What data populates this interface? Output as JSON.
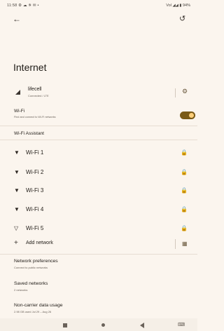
{
  "status": {
    "left": "11:58 ⚙ ☁ ✵ ✉ •",
    "right": "Vol ◢◢ ▮ 94%"
  },
  "page": {
    "title": "Internet"
  },
  "carrier": {
    "name": "lifecell",
    "sub": "Connected / LTE"
  },
  "wifi": {
    "label": "Wi-Fi",
    "sub": "Find and connect to Wi-Fi networks",
    "enabled": true
  },
  "assistant": "Wi-Fi Assistant",
  "networks": [
    "Wi-Fi 1",
    "Wi-Fi 2",
    "Wi-Fi 3",
    "Wi-Fi 4",
    "Wi-Fi 5"
  ],
  "add_network": "Add network",
  "prefs": [
    {
      "title": "Network preferences",
      "sub": "Connect to public networks"
    },
    {
      "title": "Saved networks",
      "sub": "2 networks"
    },
    {
      "title": "Non-carrier data usage",
      "sub": "2.98 GB used Jul 29 – Aug 26"
    }
  ],
  "icons": {
    "back": "back-arrow-icon",
    "help": "help-icon",
    "signal": "cell-signal-icon",
    "gear": "gear-icon",
    "wifi": "wifi-icon",
    "lock": "lock-icon",
    "plus": "plus-icon",
    "qr": "qr-icon"
  },
  "colors": {
    "accent": "#7a5a16",
    "background": "#fbf5ee"
  }
}
